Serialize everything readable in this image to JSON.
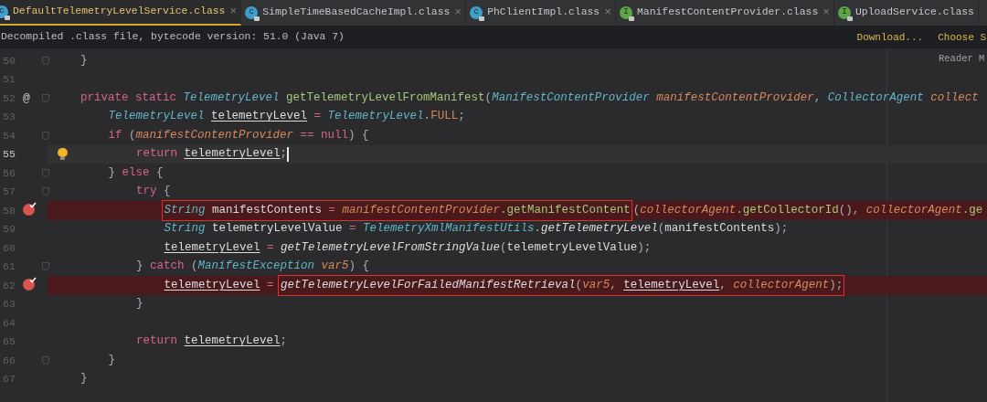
{
  "tabs": [
    {
      "label": "DefaultTelemetryLevelService.class",
      "icon_letter": "c",
      "kind": "class",
      "selected": true,
      "close": "×"
    },
    {
      "label": "SimpleTimeBasedCacheImpl.class",
      "icon_letter": "c",
      "kind": "class",
      "selected": false,
      "close": "×"
    },
    {
      "label": "PhClientImpl.class",
      "icon_letter": "c",
      "kind": "class",
      "selected": false,
      "close": "×"
    },
    {
      "label": "ManifestContentProvider.class",
      "icon_letter": "I",
      "kind": "interface",
      "selected": false,
      "close": "×"
    },
    {
      "label": "UploadService.class",
      "icon_letter": "I",
      "kind": "interface",
      "selected": false
    }
  ],
  "notice": {
    "text": "Decompiled .class file, bytecode version: 51.0 (Java 7)",
    "links": [
      "Download...",
      "Choose S"
    ]
  },
  "reader_mode": "Reader M",
  "lines": [
    {
      "number": "50",
      "fold": true,
      "tokens": [
        {
          "kind": "punct",
          "text": "}"
        }
      ]
    },
    {
      "number": "51",
      "fold": false
    },
    {
      "number": "52",
      "fold": true,
      "gutter": {
        "kind": "override",
        "text": "@"
      },
      "tokens": [
        {
          "kind": "kw",
          "text": "private static "
        },
        {
          "kind": "type",
          "text": "TelemetryLevel "
        },
        {
          "kind": "decl",
          "text": "getTelemetryLevelFromManifest"
        },
        {
          "kind": "punct",
          "text": "("
        },
        {
          "kind": "type",
          "text": "ManifestContentProvider "
        },
        {
          "kind": "param",
          "text": "manifestContentProvider"
        },
        {
          "kind": "punct",
          "text": ", "
        },
        {
          "kind": "type",
          "text": "CollectorAgent "
        },
        {
          "kind": "param",
          "text": "collect"
        }
      ],
      "children": [
        {
          "number": "53",
          "fold": false,
          "tokens": [
            {
              "kind": "type",
              "text": "TelemetryLevel "
            },
            {
              "kind": "plain",
              "text": "telemetryLevel",
              "underline": true
            },
            {
              "kind": "op",
              "text": " = "
            },
            {
              "kind": "type",
              "text": "TelemetryLevel"
            },
            {
              "kind": "punct",
              "text": "."
            },
            {
              "kind": "field",
              "text": "FULL"
            },
            {
              "kind": "punct",
              "text": ";"
            }
          ]
        },
        {
          "number": "54",
          "fold": true,
          "tokens": [
            {
              "kind": "kw",
              "text": "if "
            },
            {
              "kind": "punct",
              "text": "("
            },
            {
              "kind": "param",
              "text": "manifestContentProvider"
            },
            {
              "kind": "op",
              "text": " == "
            },
            {
              "kind": "kw",
              "text": "null"
            },
            {
              "kind": "punct",
              "text": ") {"
            }
          ],
          "children": [
            {
              "number": "55",
              "fold": false,
              "caret": true,
              "gutter": {
                "kind": "bulb"
              },
              "tokens": [
                {
                  "kind": "kw",
                  "text": "return "
                },
                {
                  "kind": "plain",
                  "text": "telemetryLevel",
                  "underline": true
                },
                {
                  "kind": "punct",
                  "text": ";"
                }
              ]
            }
          ]
        },
        {
          "number": "56",
          "fold": true,
          "tokens": [
            {
              "kind": "punct",
              "text": "} "
            },
            {
              "kind": "kw",
              "text": "else"
            },
            {
              "kind": "punct",
              "text": " {"
            }
          ],
          "children": [
            {
              "number": "57",
              "fold": true,
              "tokens": [
                {
                  "kind": "kw",
                  "text": "try"
                },
                {
                  "kind": "punct",
                  "text": " {"
                }
              ],
              "children": [
                {
                  "number": "58",
                  "fold": false,
                  "gutter": {
                    "kind": "breakpoint"
                  },
                  "tokens": [
                    {
                      "kind": "box",
                      "tokens": [
                        {
                          "kind": "type",
                          "text": "String"
                        },
                        {
                          "kind": "plain",
                          "text": " manifestContents"
                        },
                        {
                          "kind": "op",
                          "text": " = "
                        },
                        {
                          "kind": "param",
                          "text": "manifestContentProvider"
                        },
                        {
                          "kind": "punct",
                          "text": "."
                        },
                        {
                          "kind": "method",
                          "text": "getManifestContent"
                        }
                      ]
                    },
                    {
                      "kind": "punct",
                      "text": "("
                    },
                    {
                      "kind": "param",
                      "text": "collectorAgent"
                    },
                    {
                      "kind": "punct",
                      "text": "."
                    },
                    {
                      "kind": "method",
                      "text": "getCollectorId"
                    },
                    {
                      "kind": "punct",
                      "text": "(), "
                    },
                    {
                      "kind": "param",
                      "text": "collectorAgent"
                    },
                    {
                      "kind": "punct",
                      "text": "."
                    },
                    {
                      "kind": "method",
                      "text": "ge"
                    }
                  ]
                },
                {
                  "number": "59",
                  "fold": false,
                  "tokens": [
                    {
                      "kind": "type",
                      "text": "String"
                    },
                    {
                      "kind": "plain",
                      "text": " telemetryLevelValue"
                    },
                    {
                      "kind": "op",
                      "text": " = "
                    },
                    {
                      "kind": "type",
                      "text": "TelemetryXmlManifestUtils"
                    },
                    {
                      "kind": "punct",
                      "text": "."
                    },
                    {
                      "kind": "static",
                      "text": "getTelemetryLevel"
                    },
                    {
                      "kind": "punct",
                      "text": "("
                    },
                    {
                      "kind": "plain",
                      "text": "manifestContents"
                    },
                    {
                      "kind": "punct",
                      "text": ");"
                    }
                  ]
                },
                {
                  "number": "60",
                  "fold": false,
                  "tokens": [
                    {
                      "kind": "plain",
                      "text": "telemetryLevel",
                      "underline": true
                    },
                    {
                      "kind": "op",
                      "text": " = "
                    },
                    {
                      "kind": "static",
                      "text": "getTelemetryLevelFromStringValue"
                    },
                    {
                      "kind": "punct",
                      "text": "("
                    },
                    {
                      "kind": "plain",
                      "text": "telemetryLevelValue"
                    },
                    {
                      "kind": "punct",
                      "text": ");"
                    }
                  ]
                }
              ]
            },
            {
              "number": "61",
              "fold": true,
              "tokens": [
                {
                  "kind": "punct",
                  "text": "} "
                },
                {
                  "kind": "kw",
                  "text": "catch"
                },
                {
                  "kind": "punct",
                  "text": " ("
                },
                {
                  "kind": "type",
                  "text": "ManifestException "
                },
                {
                  "kind": "param",
                  "text": "var5"
                },
                {
                  "kind": "punct",
                  "text": ") {"
                }
              ],
              "children": [
                {
                  "number": "62",
                  "fold": false,
                  "gutter": {
                    "kind": "breakpoint"
                  },
                  "tokens": [
                    {
                      "kind": "plain",
                      "text": "telemetryLevel",
                      "underline": true
                    },
                    {
                      "kind": "op",
                      "text": " = "
                    },
                    {
                      "kind": "box",
                      "tokens": [
                        {
                          "kind": "static",
                          "text": "getTelemetryLevelForFailedManifestRetrieval"
                        },
                        {
                          "kind": "punct",
                          "text": "("
                        },
                        {
                          "kind": "param",
                          "text": "var5"
                        },
                        {
                          "kind": "punct",
                          "text": ", "
                        },
                        {
                          "kind": "plain",
                          "text": "telemetryLevel",
                          "underline": true
                        },
                        {
                          "kind": "punct",
                          "text": ", "
                        },
                        {
                          "kind": "param",
                          "text": "collectorAgent"
                        },
                        {
                          "kind": "punct",
                          "text": ");"
                        }
                      ]
                    }
                  ]
                }
              ]
            },
            {
              "number": "63",
              "fold": false,
              "tokens": [
                {
                  "kind": "punct",
                  "text": "}"
                }
              ]
            },
            {
              "number": "64",
              "fold": false
            },
            {
              "number": "65",
              "fold": false,
              "tokens": [
                {
                  "kind": "kw",
                  "text": "return "
                },
                {
                  "kind": "plain",
                  "text": "telemetryLevel",
                  "underline": true
                },
                {
                  "kind": "punct",
                  "text": ";"
                }
              ]
            }
          ]
        },
        {
          "number": "66",
          "fold": true,
          "tokens": [
            {
              "kind": "punct",
              "text": "}"
            }
          ]
        }
      ]
    },
    {
      "number": "67",
      "fold": false,
      "tokens": [
        {
          "kind": "punct",
          "text": "}"
        }
      ]
    }
  ]
}
